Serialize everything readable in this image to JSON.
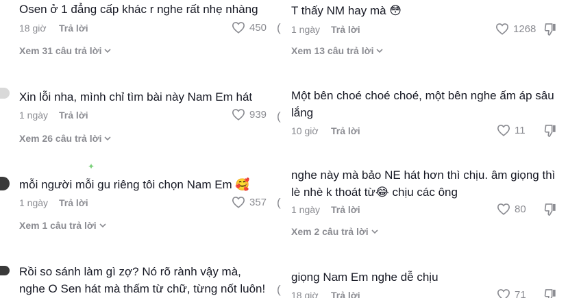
{
  "left_column": {
    "comments": [
      {
        "text": "Osen ở 1 đẳng cấp khác r nghe rất nhẹ nhàng",
        "time": "18 giờ",
        "reply_label": "Trả lời",
        "likes": "450",
        "replies_label": "Xem 31 câu trả lời"
      },
      {
        "text": "Xin lỗi nha, mình chỉ tìm bài này Nam Em hát",
        "time": "1 ngày",
        "reply_label": "Trả lời",
        "likes": "939",
        "replies_label": "Xem 26 câu trả lời"
      },
      {
        "text": "mỗi người mỗi gu riêng tôi chọn Nam Em 🥰",
        "time": "1 ngày",
        "reply_label": "Trả lời",
        "likes": "357",
        "replies_label": "Xem 1 câu trả lời"
      },
      {
        "text": "Rồi so sánh làm gì zợ? Nó rõ rành vậy mà, nghe O Sen hát mà thấm từ chữ, từng nốt luôn!"
      }
    ]
  },
  "right_column": {
    "comments": [
      {
        "text": "T thấy NM hay mà 😳",
        "time": "1 ngày",
        "reply_label": "Trả lời",
        "likes": "1268",
        "replies_label": "Xem 13 câu trả lời"
      },
      {
        "text": "Một bên choé choé choé, một bên nghe ấm áp sâu lắng",
        "time": "10 giờ",
        "reply_label": "Trả lời",
        "likes": "11"
      },
      {
        "text": "nghe này mà bảo NE hát hơn thì chịu. âm giọng thì lè nhè k thoát từ😂 chịu các ông",
        "time": "1 ngày",
        "reply_label": "Trả lời",
        "likes": "80",
        "replies_label": "Xem 2 câu trả lời"
      },
      {
        "text": "giọng Nam Em nghe dễ chịu",
        "time": "18 giờ",
        "reply_label": "Trả lời",
        "likes": "71"
      }
    ]
  },
  "icons": {
    "like": "heart-outline-icon",
    "dislike": "thumb-down-icon",
    "expand": "chevron-down-icon"
  },
  "colors": {
    "text": "#161823",
    "meta": "#8a8b91"
  }
}
